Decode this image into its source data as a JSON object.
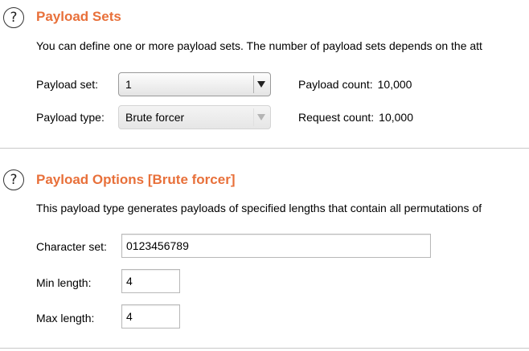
{
  "payload_sets": {
    "title": "Payload Sets",
    "help_icon": "help-icon",
    "description": "You can define one or more payload sets. The number of payload sets depends on the att",
    "payload_set_label": "Payload set:",
    "payload_set_value": "1",
    "payload_type_label": "Payload type:",
    "payload_type_value": "Brute forcer",
    "payload_count_label": "Payload count:",
    "payload_count_value": "10,000",
    "request_count_label": "Request count:",
    "request_count_value": "10,000"
  },
  "payload_options": {
    "title": "Payload Options [Brute forcer]",
    "help_icon": "help-icon",
    "description": "This payload type generates payloads of specified lengths that contain all permutations of",
    "character_set_label": "Character set:",
    "character_set_value": "0123456789",
    "min_length_label": "Min length:",
    "min_length_value": "4",
    "max_length_label": "Max length:",
    "max_length_value": "4"
  },
  "colors": {
    "title_accent": "#e8703a",
    "divider": "#c8c8c8"
  }
}
